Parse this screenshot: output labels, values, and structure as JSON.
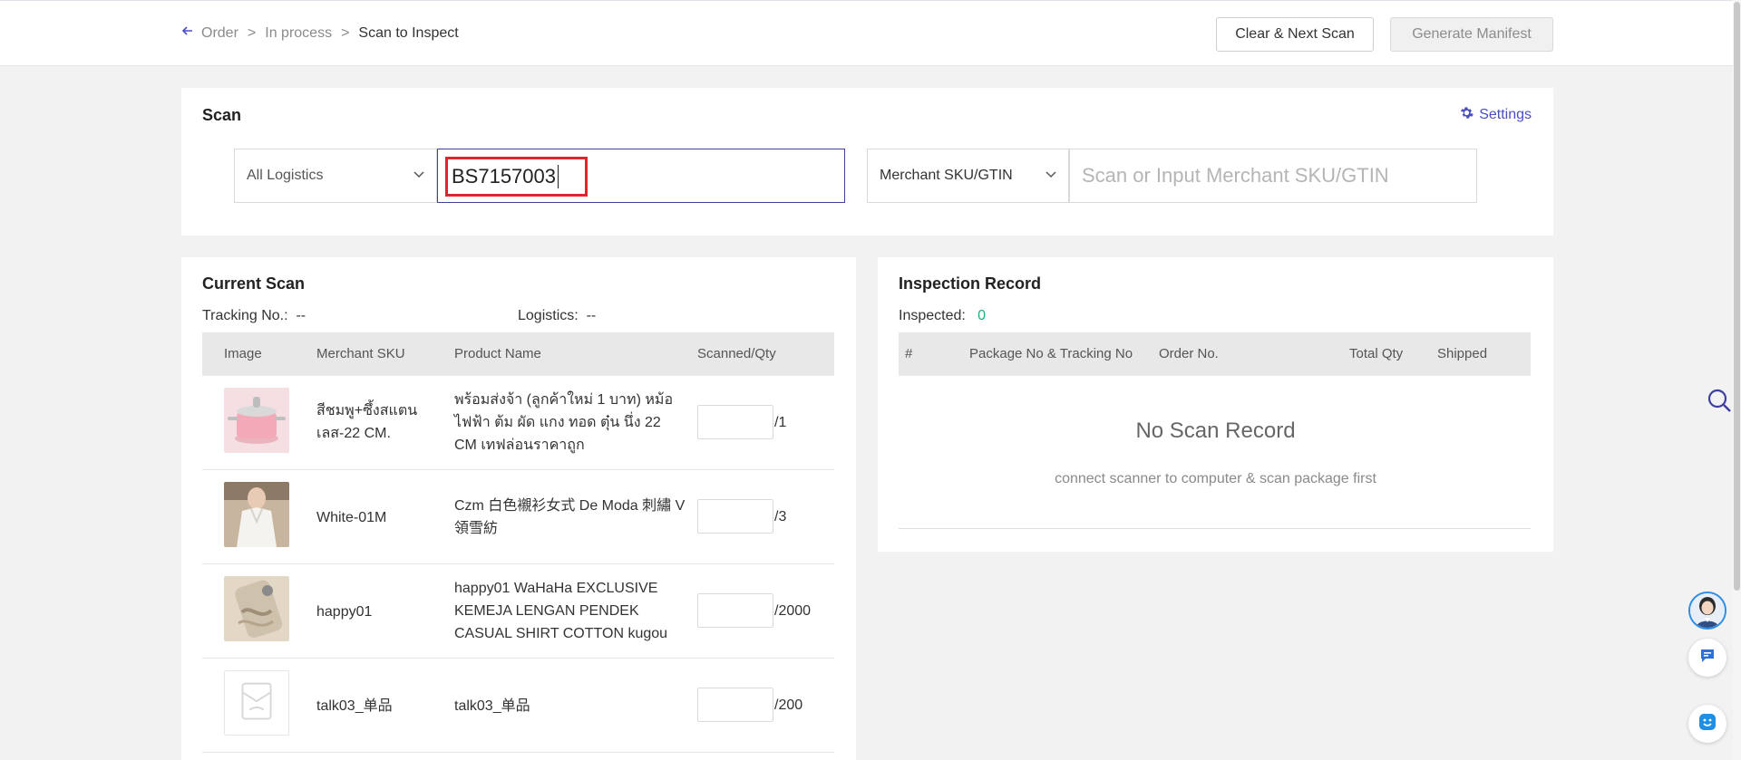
{
  "breadcrumb": {
    "items": [
      "Order",
      "In process",
      "Scan to Inspect"
    ],
    "separator": ">"
  },
  "toolbar": {
    "clear_label": "Clear & Next Scan",
    "generate_label": "Generate Manifest"
  },
  "scan": {
    "title": "Scan",
    "settings_label": "Settings",
    "logistics_select": "All Logistics",
    "tracking_value": "BS7157003",
    "sku_type_select": "Merchant SKU/GTIN",
    "sku_placeholder": "Scan or Input Merchant SKU/GTIN"
  },
  "current_scan": {
    "title": "Current Scan",
    "tracking_label": "Tracking No.:",
    "tracking_value": "--",
    "logistics_label": "Logistics:",
    "logistics_value": "--",
    "columns": [
      "Image",
      "Merchant SKU",
      "Product Name",
      "Scanned/Qty"
    ],
    "rows": [
      {
        "sku": "สีชมพู+ซึ้งสแตนเลส-22 CM.",
        "name": "พร้อมส่งจ้า (ลูกค้าใหม่ 1 บาท) หม้อไฟฟ้า ต้ม ผัด แกง ทอด ตุ๋น นึ่ง 22 CM เทฟล่อนราคาถูก",
        "qty": "/1",
        "image": "pink-pot"
      },
      {
        "sku": "White-01M",
        "name": "Czm 白色襯衫女式 De Moda 刺繡 V 領雪紡",
        "qty": "/3",
        "image": "white-shirt"
      },
      {
        "sku": "happy01",
        "name": "happy01 WaHaHa EXCLUSIVE KEMEJA LENGAN PENDEK CASUAL SHIRT COTTON kugou",
        "qty": "/2000",
        "image": "phone-case"
      },
      {
        "sku": "talk03_单品",
        "name": "talk03_单品",
        "qty": "/200",
        "image": "no-image"
      }
    ]
  },
  "inspection": {
    "title": "Inspection Record",
    "inspected_label": "Inspected:",
    "inspected_value": "0",
    "columns": [
      "#",
      "Package No & Tracking No",
      "Order No.",
      "Total Qty",
      "Shipped"
    ],
    "empty_title": "No Scan Record",
    "empty_subtitle": "connect scanner to computer & scan package first"
  },
  "colors": {
    "accent": "#4a4fbf",
    "highlight": "#e0242b",
    "success": "#19b37b"
  }
}
